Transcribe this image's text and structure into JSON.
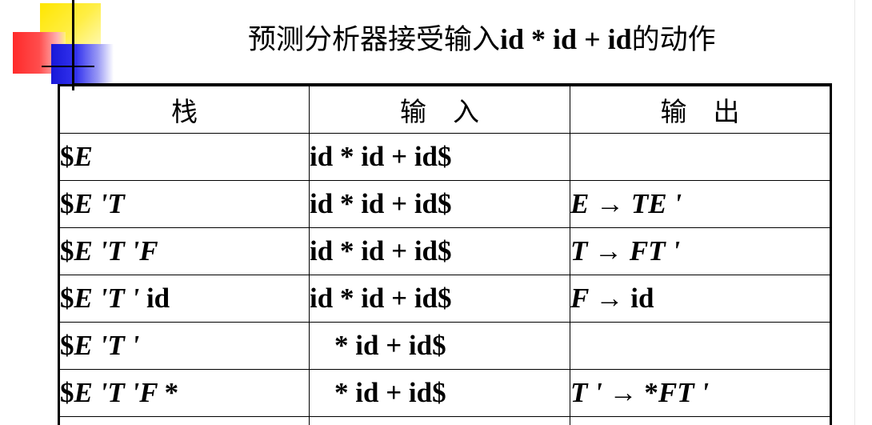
{
  "title": {
    "prefix": "预测分析器接受输入",
    "expression": "id * id + id",
    "suffix": "的动作"
  },
  "table": {
    "headers": [
      "栈",
      "输　入",
      "输　出"
    ],
    "rows": [
      {
        "stack": "$E",
        "input": "id * id + id$",
        "output": ""
      },
      {
        "stack": "$E 'T",
        "input": "id * id + id$",
        "output": "E → TE '"
      },
      {
        "stack": "$E 'T 'F",
        "input": "id * id + id$",
        "output": "T → FT '"
      },
      {
        "stack": "$E 'T ' id",
        "input": "id * id + id$",
        "output": "F → id"
      },
      {
        "stack": "$E 'T '",
        "input": "* id + id$",
        "output": ""
      },
      {
        "stack": "$E 'T 'F *",
        "input": "* id + id$",
        "output": "T ' → *FT '"
      }
    ]
  },
  "colors": {
    "logo_yellow": "#ffe600",
    "logo_red": "#ff2a2a",
    "logo_blue": "#1818d8"
  }
}
